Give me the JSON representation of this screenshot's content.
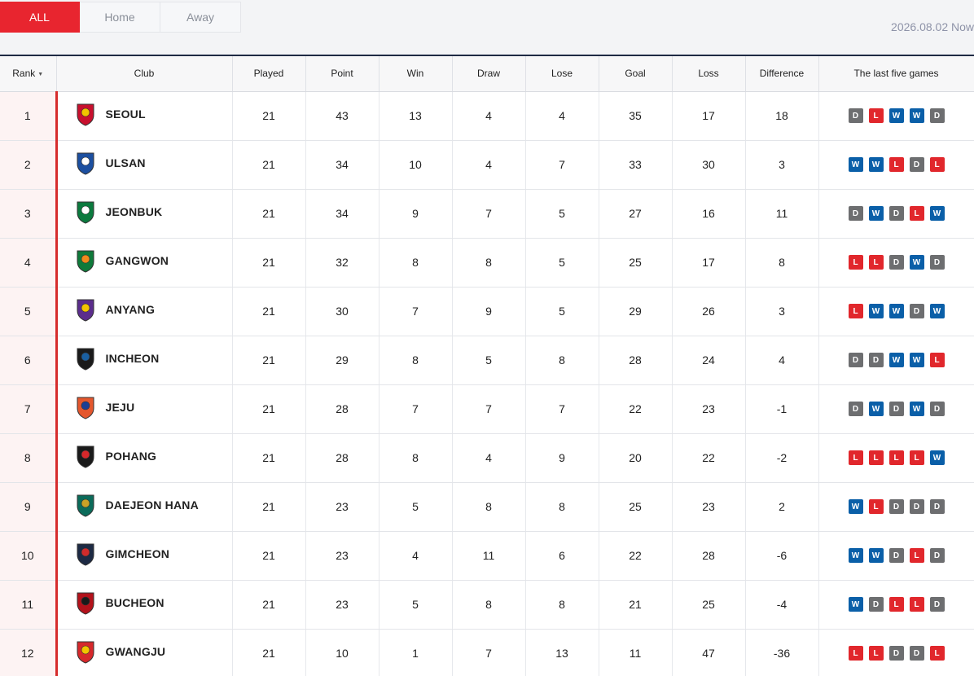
{
  "tabs": [
    {
      "label": "ALL",
      "active": true
    },
    {
      "label": "Home",
      "active": false
    },
    {
      "label": "Away",
      "active": false
    }
  ],
  "updated_text": "2026.08.02 Now",
  "headers": {
    "rank": "Rank",
    "club": "Club",
    "played": "Played",
    "point": "Point",
    "win": "Win",
    "draw": "Draw",
    "lose": "Lose",
    "goal": "Goal",
    "loss": "Loss",
    "difference": "Difference",
    "last_five": "The last five games"
  },
  "sort_icon": "triangle-down",
  "result_colors": {
    "W": "#0a5fa8",
    "D": "#6d6e70",
    "L": "#e1272c"
  },
  "rows": [
    {
      "rank": "1",
      "club": "SEOUL",
      "crest": {
        "icon": "seoul-crest",
        "colors": [
          "#c8102e",
          "#f2c400"
        ]
      },
      "played": "21",
      "point": "43",
      "win": "13",
      "draw": "4",
      "lose": "4",
      "goal": "35",
      "loss": "17",
      "difference": "18",
      "form": [
        "D",
        "L",
        "W",
        "W",
        "D"
      ]
    },
    {
      "rank": "2",
      "club": "ULSAN",
      "crest": {
        "icon": "ulsan-crest",
        "colors": [
          "#1c4fa0",
          "#ffffff"
        ]
      },
      "played": "21",
      "point": "34",
      "win": "10",
      "draw": "4",
      "lose": "7",
      "goal": "33",
      "loss": "30",
      "difference": "3",
      "form": [
        "W",
        "W",
        "L",
        "D",
        "L"
      ]
    },
    {
      "rank": "3",
      "club": "JEONBUK",
      "crest": {
        "icon": "jeonbuk-crest",
        "colors": [
          "#0b7a3e",
          "#ffffff"
        ]
      },
      "played": "21",
      "point": "34",
      "win": "9",
      "draw": "7",
      "lose": "5",
      "goal": "27",
      "loss": "16",
      "difference": "11",
      "form": [
        "D",
        "W",
        "D",
        "L",
        "W"
      ]
    },
    {
      "rank": "4",
      "club": "GANGWON",
      "crest": {
        "icon": "gangwon-crest",
        "colors": [
          "#0f7a3a",
          "#f08a1c"
        ]
      },
      "played": "21",
      "point": "32",
      "win": "8",
      "draw": "8",
      "lose": "5",
      "goal": "25",
      "loss": "17",
      "difference": "8",
      "form": [
        "L",
        "L",
        "D",
        "W",
        "D"
      ]
    },
    {
      "rank": "5",
      "club": "ANYANG",
      "crest": {
        "icon": "anyang-crest",
        "colors": [
          "#5b2d8c",
          "#f2c400"
        ]
      },
      "played": "21",
      "point": "30",
      "win": "7",
      "draw": "9",
      "lose": "5",
      "goal": "29",
      "loss": "26",
      "difference": "3",
      "form": [
        "L",
        "W",
        "W",
        "D",
        "W"
      ]
    },
    {
      "rank": "6",
      "club": "INCHEON",
      "crest": {
        "icon": "incheon-crest",
        "colors": [
          "#1a1a1a",
          "#1a5fa0"
        ]
      },
      "played": "21",
      "point": "29",
      "win": "8",
      "draw": "5",
      "lose": "8",
      "goal": "28",
      "loss": "24",
      "difference": "4",
      "form": [
        "D",
        "D",
        "W",
        "W",
        "L"
      ]
    },
    {
      "rank": "7",
      "club": "JEJU",
      "crest": {
        "icon": "jeju-crest",
        "colors": [
          "#e4572e",
          "#1c3f94"
        ]
      },
      "played": "21",
      "point": "28",
      "win": "7",
      "draw": "7",
      "lose": "7",
      "goal": "22",
      "loss": "23",
      "difference": "-1",
      "form": [
        "D",
        "W",
        "D",
        "W",
        "D"
      ]
    },
    {
      "rank": "8",
      "club": "POHANG",
      "crest": {
        "icon": "pohang-crest",
        "colors": [
          "#1a1a1a",
          "#d6282b"
        ]
      },
      "played": "21",
      "point": "28",
      "win": "8",
      "draw": "4",
      "lose": "9",
      "goal": "20",
      "loss": "22",
      "difference": "-2",
      "form": [
        "L",
        "L",
        "L",
        "L",
        "W"
      ]
    },
    {
      "rank": "9",
      "club": "DAEJEON HANA",
      "crest": {
        "icon": "daejeon-crest",
        "colors": [
          "#0b6b5a",
          "#c9a227"
        ]
      },
      "played": "21",
      "point": "23",
      "win": "5",
      "draw": "8",
      "lose": "8",
      "goal": "25",
      "loss": "23",
      "difference": "2",
      "form": [
        "W",
        "L",
        "D",
        "D",
        "D"
      ]
    },
    {
      "rank": "10",
      "club": "GIMCHEON",
      "crest": {
        "icon": "gimcheon-crest",
        "colors": [
          "#1d2a44",
          "#d12b2b"
        ]
      },
      "played": "21",
      "point": "23",
      "win": "4",
      "draw": "11",
      "lose": "6",
      "goal": "22",
      "loss": "28",
      "difference": "-6",
      "form": [
        "W",
        "W",
        "D",
        "L",
        "D"
      ]
    },
    {
      "rank": "11",
      "club": "BUCHEON",
      "crest": {
        "icon": "bucheon-crest",
        "colors": [
          "#b3121b",
          "#1a1a1a"
        ]
      },
      "played": "21",
      "point": "23",
      "win": "5",
      "draw": "8",
      "lose": "8",
      "goal": "21",
      "loss": "25",
      "difference": "-4",
      "form": [
        "W",
        "D",
        "L",
        "L",
        "D"
      ]
    },
    {
      "rank": "12",
      "club": "GWANGJU",
      "crest": {
        "icon": "gwangju-crest",
        "colors": [
          "#d6282b",
          "#f2c400"
        ]
      },
      "played": "21",
      "point": "10",
      "win": "1",
      "draw": "7",
      "lose": "13",
      "goal": "11",
      "loss": "47",
      "difference": "-36",
      "form": [
        "L",
        "L",
        "D",
        "D",
        "L"
      ]
    }
  ]
}
